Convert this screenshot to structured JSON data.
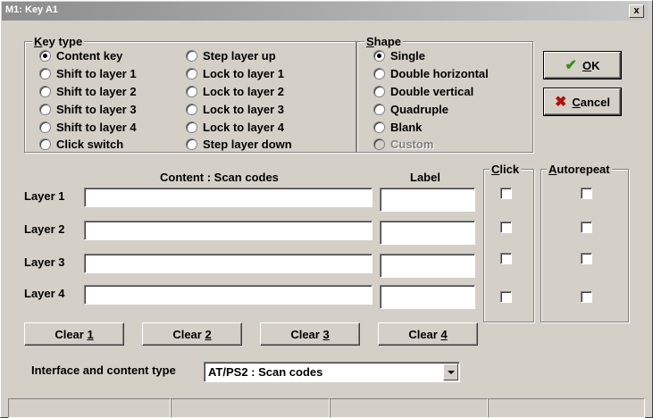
{
  "window": {
    "title": "M1: Key A1",
    "close_label": "x"
  },
  "key_type": {
    "legend_u": "K",
    "legend_rest": "ey type",
    "options": [
      {
        "label": "Content key",
        "selected": true
      },
      {
        "label": "Shift to layer 1",
        "selected": false
      },
      {
        "label": "Shift to layer 2",
        "selected": false
      },
      {
        "label": "Shift to layer 3",
        "selected": false
      },
      {
        "label": "Shift to layer 4",
        "selected": false
      },
      {
        "label": "Click switch",
        "selected": false
      },
      {
        "label": "Step layer up",
        "selected": false
      },
      {
        "label": "Lock to layer 1",
        "selected": false
      },
      {
        "label": "Lock to layer 2",
        "selected": false
      },
      {
        "label": "Lock to layer 3",
        "selected": false
      },
      {
        "label": "Lock to layer 4",
        "selected": false
      },
      {
        "label": "Step layer down",
        "selected": false
      }
    ]
  },
  "shape": {
    "legend_u": "S",
    "legend_rest": "hape",
    "options": [
      {
        "label": "Single",
        "selected": true
      },
      {
        "label": "Double horizontal",
        "selected": false
      },
      {
        "label": "Double vertical",
        "selected": false
      },
      {
        "label": "Quadruple",
        "selected": false
      },
      {
        "label": "Blank",
        "selected": false
      },
      {
        "label": "Custom",
        "selected": false,
        "disabled": true
      }
    ]
  },
  "buttons": {
    "ok_u": "O",
    "ok_rest": "K",
    "cancel_u": "C",
    "cancel_rest": "ancel",
    "ok_icon": "checkmark-icon",
    "cancel_icon": "x-icon",
    "ok_color": "#3a8a1a",
    "cancel_color": "#b01010"
  },
  "layers": {
    "content_header": "Content : Scan codes",
    "label_header": "Label",
    "rows": [
      {
        "name": "Layer 1",
        "content": "",
        "label": ""
      },
      {
        "name": "Layer 2",
        "content": "",
        "label": ""
      },
      {
        "name": "Layer 3",
        "content": "",
        "label": ""
      },
      {
        "name": "Layer 4",
        "content": "",
        "label": ""
      }
    ]
  },
  "click": {
    "legend_u": "C",
    "legend_rest": "lick"
  },
  "autorepeat": {
    "legend_u": "A",
    "legend_rest": "utorepeat"
  },
  "clear_buttons": [
    {
      "prefix": "Clear ",
      "u": "1"
    },
    {
      "prefix": "Clear ",
      "u": "2"
    },
    {
      "prefix": "Clear ",
      "u": "3"
    },
    {
      "prefix": "Clear ",
      "u": "4"
    }
  ],
  "interface": {
    "label": "Interface and content type",
    "value": "AT/PS2 : Scan codes"
  },
  "status_bar": [
    "",
    "",
    "",
    ""
  ]
}
